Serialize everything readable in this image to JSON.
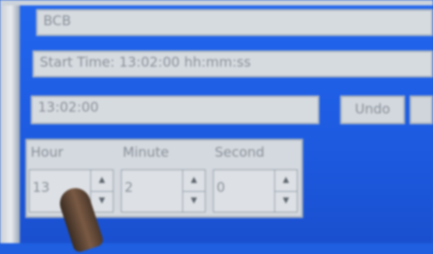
{
  "header": {
    "top_field_text": "BCB"
  },
  "start_time": {
    "label": "Start Time:  13:02:00 hh:mm:ss"
  },
  "time_display": {
    "value": "13:02:00"
  },
  "undo": {
    "label": "Undo"
  },
  "spinners": {
    "hour": {
      "label": "Hour",
      "value": "13",
      "up_icon": "▲",
      "down_icon": "▼"
    },
    "minute": {
      "label": "Minute",
      "value": "2",
      "up_icon": "▲",
      "down_icon": "▼"
    },
    "second": {
      "label": "Second",
      "value": "0",
      "up_icon": "▲",
      "down_icon": "▼"
    }
  }
}
